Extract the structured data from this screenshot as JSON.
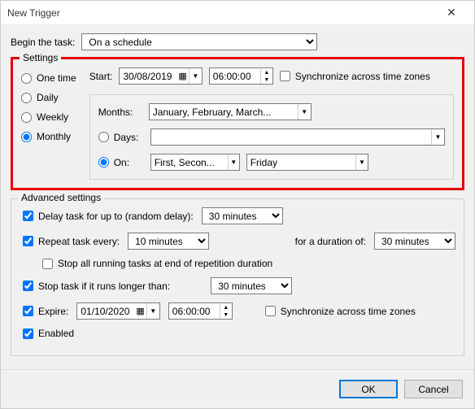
{
  "title": "New Trigger",
  "begin_task_label": "Begin the task:",
  "begin_task_value": "On a schedule",
  "settings": {
    "legend": "Settings",
    "frequency": {
      "one_time": "One time",
      "daily": "Daily",
      "weekly": "Weekly",
      "monthly": "Monthly"
    },
    "start_label": "Start:",
    "start_date": "30/08/2019",
    "start_time": "06:00:00",
    "sync_tz": "Synchronize across time zones",
    "months_label": "Months:",
    "months_value": "January, February, March...",
    "days_label": "Days:",
    "days_value": "",
    "on_label": "On:",
    "on_weeks": "First, Secon...",
    "on_day": "Friday"
  },
  "advanced": {
    "legend": "Advanced settings",
    "delay_label": "Delay task for up to (random delay):",
    "delay_value": "30 minutes",
    "repeat_label": "Repeat task every:",
    "repeat_value": "10 minutes",
    "duration_label": "for a duration of:",
    "duration_value": "30 minutes",
    "stop_all_label": "Stop all running tasks at end of repetition duration",
    "stop_if_label": "Stop task if it runs longer than:",
    "stop_if_value": "30 minutes",
    "expire_label": "Expire:",
    "expire_date": "01/10/2020",
    "expire_time": "06:00:00",
    "sync_tz": "Synchronize across time zones",
    "enabled_label": "Enabled"
  },
  "buttons": {
    "ok": "OK",
    "cancel": "Cancel"
  }
}
